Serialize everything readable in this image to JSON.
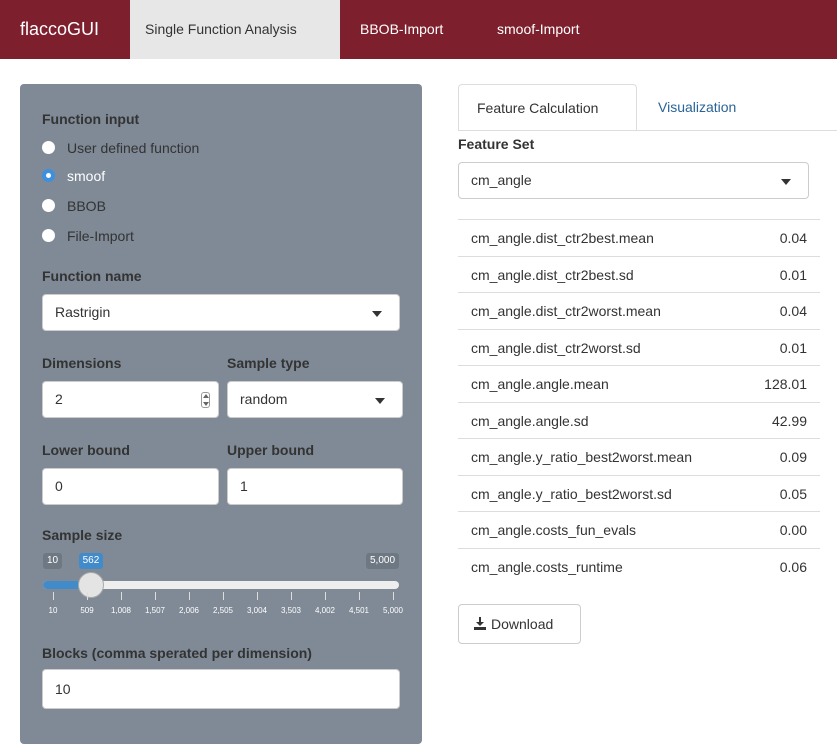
{
  "navbar": {
    "brand": "flaccoGUI",
    "tabs": [
      {
        "label": "Single Function Analysis",
        "active": true
      },
      {
        "label": "BBOB-Import",
        "active": false
      },
      {
        "label": "smoof-Import",
        "active": false
      }
    ]
  },
  "sidebar": {
    "function_input_label": "Function input",
    "radios": [
      {
        "label": "User defined function",
        "checked": false
      },
      {
        "label": "smoof",
        "checked": true
      },
      {
        "label": "BBOB",
        "checked": false
      },
      {
        "label": "File-Import",
        "checked": false
      }
    ],
    "function_name_label": "Function name",
    "function_name_value": "Rastrigin",
    "dimensions_label": "Dimensions",
    "dimensions_value": "2",
    "sample_type_label": "Sample type",
    "sample_type_value": "random",
    "lower_bound_label": "Lower bound",
    "lower_bound_value": "0",
    "upper_bound_label": "Upper bound",
    "upper_bound_value": "1",
    "sample_size_label": "Sample size",
    "slider": {
      "min_label": "10",
      "max_label": "5,000",
      "value_label": "562",
      "min": 10,
      "max": 5000,
      "value": 562,
      "ticks": [
        "10",
        "509",
        "1,008",
        "1,507",
        "2,006",
        "2,505",
        "3,004",
        "3,503",
        "4,002",
        "4,501",
        "5,000"
      ]
    },
    "blocks_label": "Blocks (comma sperated per dimension)",
    "blocks_value": "10"
  },
  "main": {
    "tabs": [
      {
        "label": "Feature Calculation",
        "active": true
      },
      {
        "label": "Visualization",
        "active": false
      }
    ],
    "feature_set_label": "Feature Set",
    "feature_set_value": "cm_angle",
    "features": [
      {
        "name": "cm_angle.dist_ctr2best.mean",
        "value": "0.04"
      },
      {
        "name": "cm_angle.dist_ctr2best.sd",
        "value": "0.01"
      },
      {
        "name": "cm_angle.dist_ctr2worst.mean",
        "value": "0.04"
      },
      {
        "name": "cm_angle.dist_ctr2worst.sd",
        "value": "0.01"
      },
      {
        "name": "cm_angle.angle.mean",
        "value": "128.01"
      },
      {
        "name": "cm_angle.angle.sd",
        "value": "42.99"
      },
      {
        "name": "cm_angle.y_ratio_best2worst.mean",
        "value": "0.09"
      },
      {
        "name": "cm_angle.y_ratio_best2worst.sd",
        "value": "0.05"
      },
      {
        "name": "cm_angle.costs_fun_evals",
        "value": "0.00"
      },
      {
        "name": "cm_angle.costs_runtime",
        "value": "0.06"
      }
    ],
    "download_label": "Download"
  },
  "colors": {
    "navbar": "#7d1f2d",
    "sidebar": "#7f8a96",
    "accent": "#428bca"
  }
}
